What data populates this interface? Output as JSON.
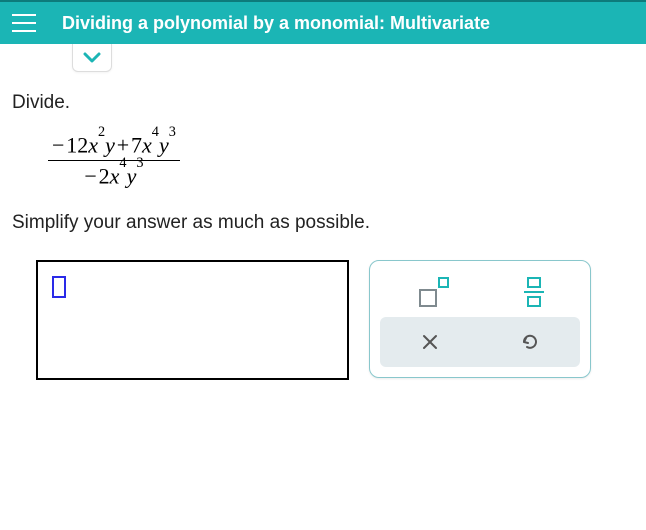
{
  "header": {
    "title": "Dividing a polynomial by a monomial: Multivariate"
  },
  "problem": {
    "prompt": "Divide.",
    "numerator_text": "− 12x²y + 7x⁴y³",
    "denominator_text": "− 2x⁴y³",
    "simplify": "Simplify your answer as much as possible."
  },
  "icon_names": {
    "menu": "menu-icon",
    "chevron_down": "chevron-down-icon",
    "superscript": "superscript-tool",
    "fraction": "fraction-tool",
    "clear": "clear-icon",
    "undo": "undo-icon"
  }
}
